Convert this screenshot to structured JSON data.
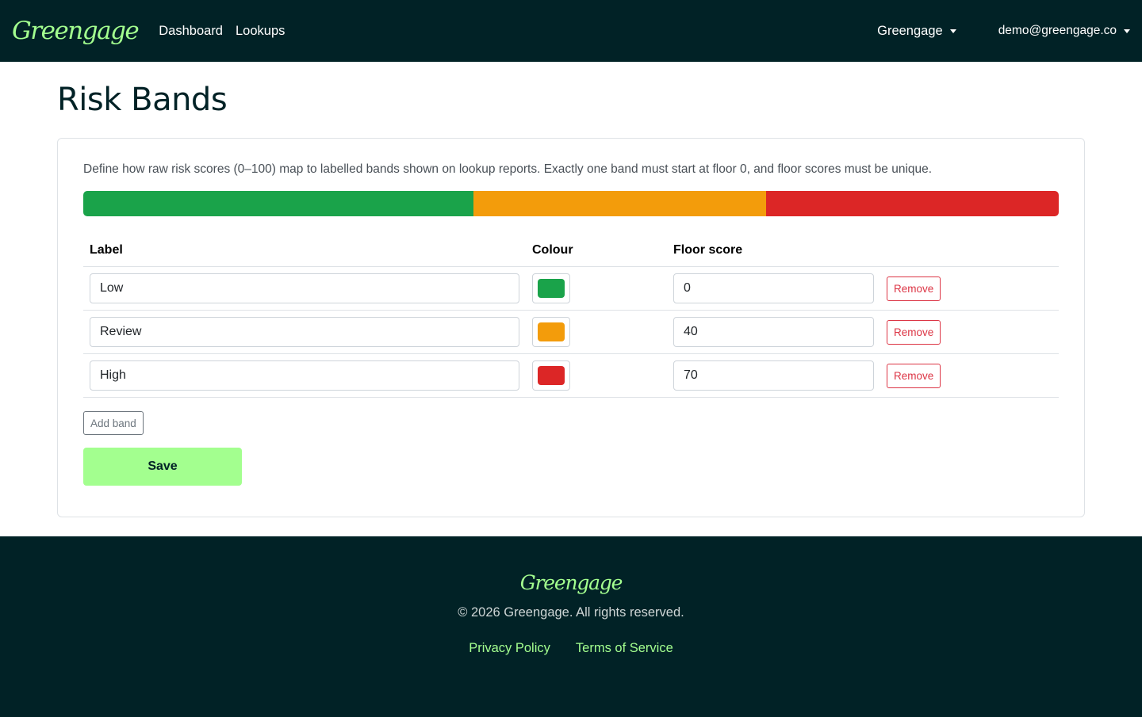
{
  "nav": {
    "brand": "Greengage",
    "links": [
      "Dashboard",
      "Lookups"
    ],
    "org": "Greengage",
    "user": "demo@greengage.co"
  },
  "page": {
    "title": "Risk Bands",
    "description": "Define how raw risk scores (0–100) map to labelled bands shown on lookup reports. Exactly one band must start at floor 0, and floor scores must be unique."
  },
  "table": {
    "headers": [
      "Label",
      "Colour",
      "Floor score"
    ],
    "remove_label": "Remove"
  },
  "bands": [
    {
      "label": "Low",
      "colour": "#1aa34a",
      "floor": "0"
    },
    {
      "label": "Review",
      "colour": "#f39c0b",
      "floor": "40"
    },
    {
      "label": "High",
      "colour": "#dc2626",
      "floor": "70"
    }
  ],
  "actions": {
    "add": "Add band",
    "save": "Save"
  },
  "footer": {
    "brand": "Greengage",
    "copyright": "© 2026 Greengage. All rights reserved.",
    "privacy": "Privacy Policy",
    "terms": "Terms of Service"
  }
}
